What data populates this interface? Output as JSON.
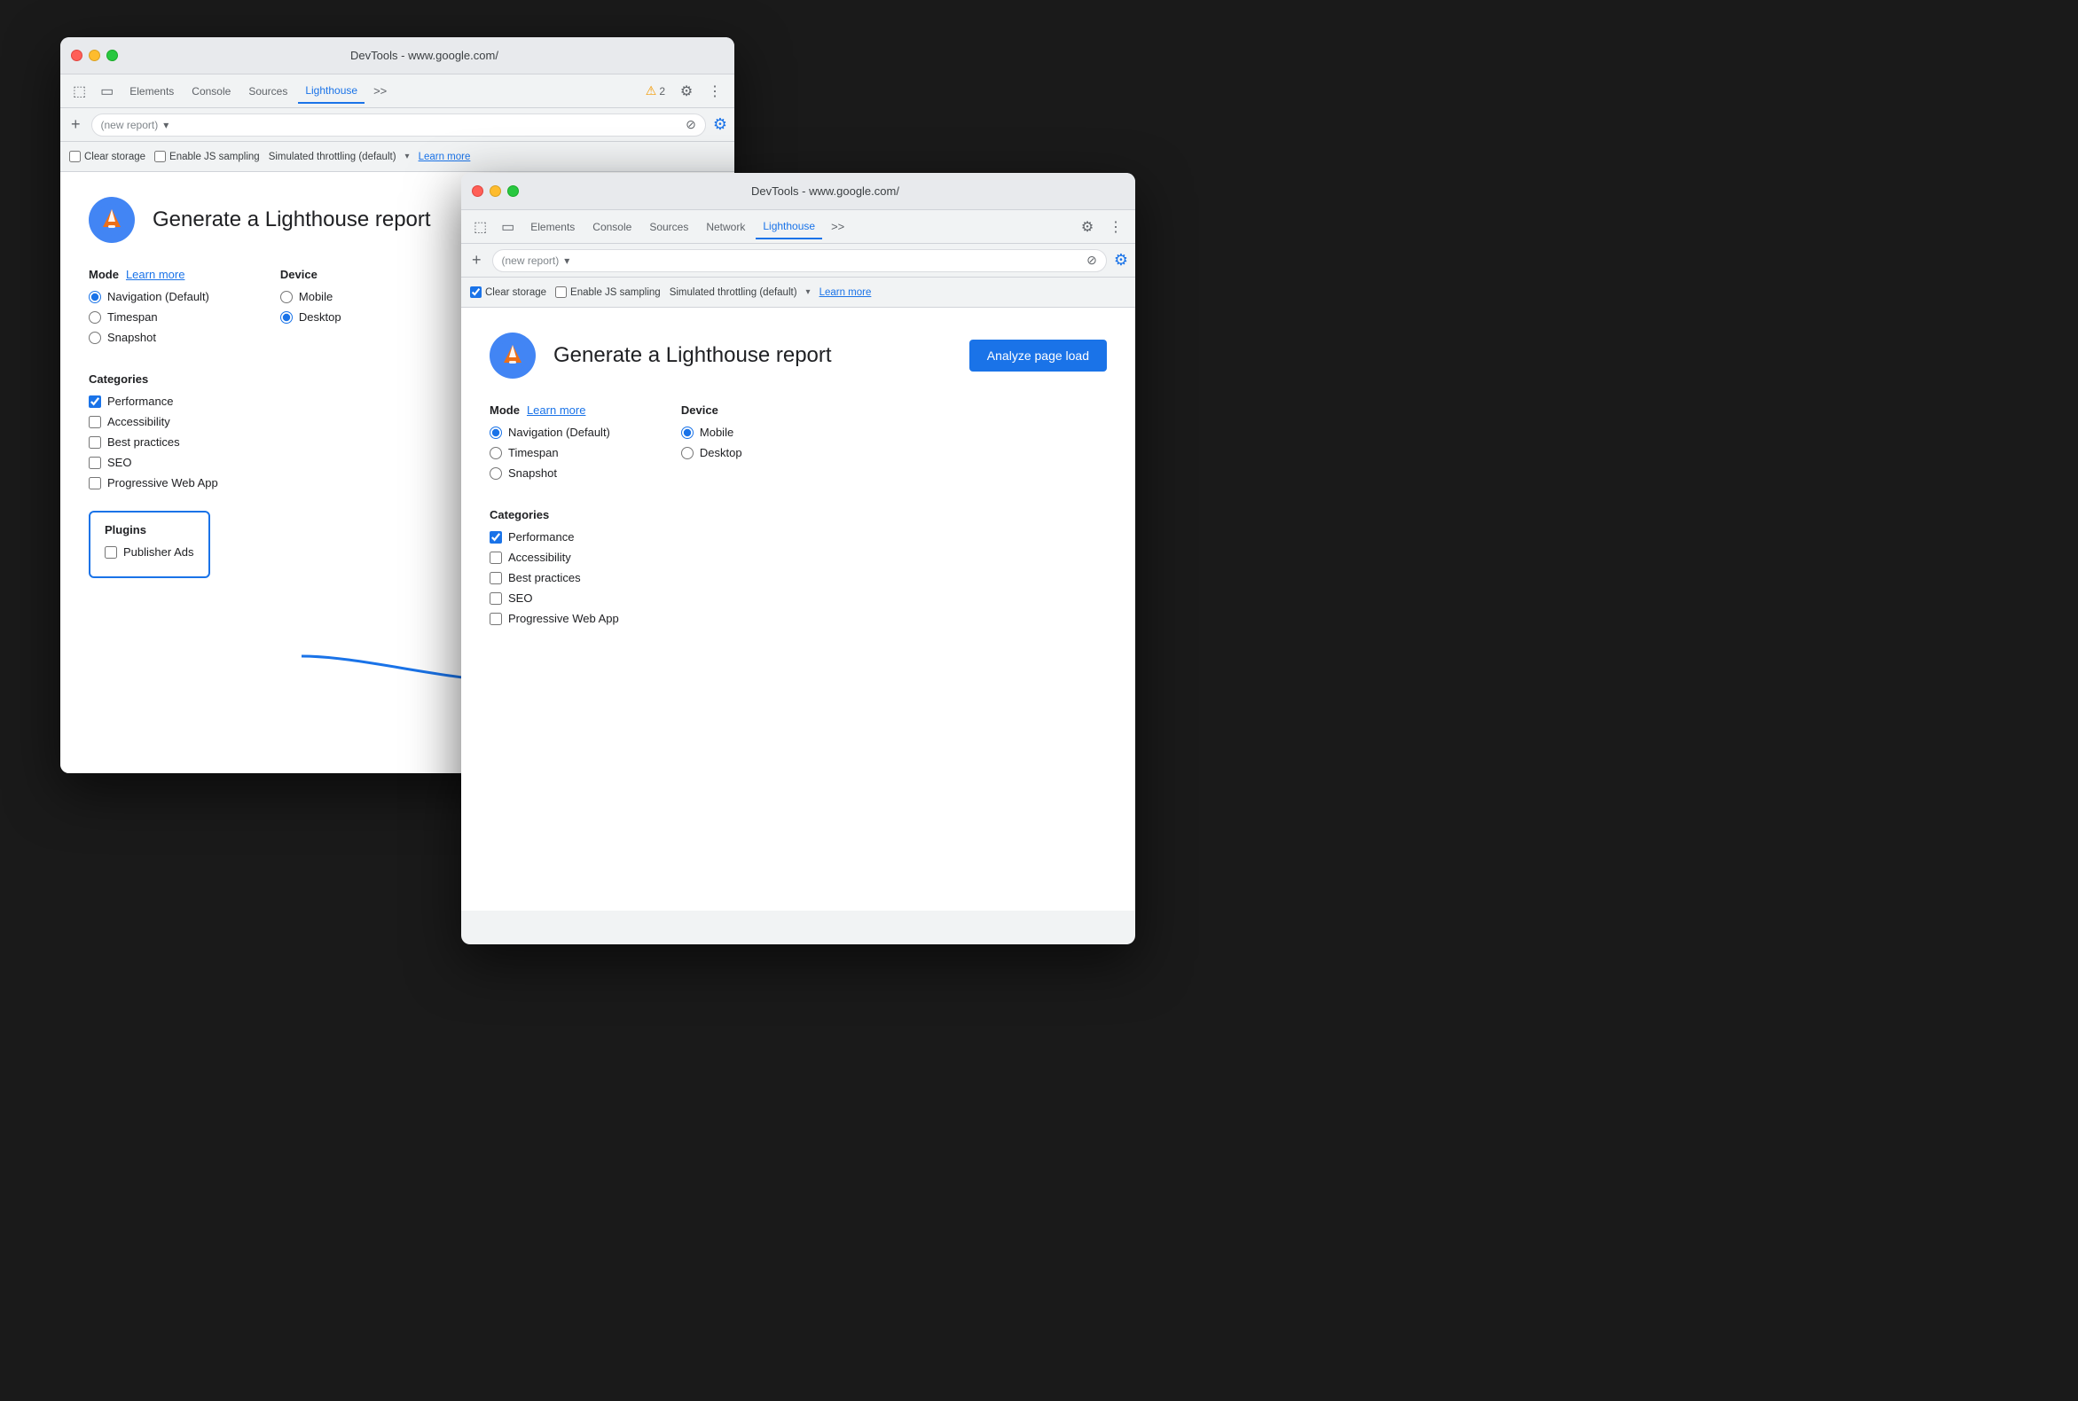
{
  "window1": {
    "titlebar": {
      "title": "DevTools - www.google.com/"
    },
    "tabs": [
      {
        "label": "Elements",
        "active": false
      },
      {
        "label": "Console",
        "active": false
      },
      {
        "label": "Sources",
        "active": false
      },
      {
        "label": "Lighthouse",
        "active": true
      }
    ],
    "more_btn": ">>",
    "warning_count": "2",
    "report_placeholder": "(new report)",
    "options": {
      "clear_storage": "Clear storage",
      "clear_storage_checked": false,
      "enable_js": "Enable JS sampling",
      "enable_js_checked": false,
      "throttling": "Simulated throttling (default)",
      "learn_more": "Learn more"
    },
    "main": {
      "logo_alt": "Lighthouse logo",
      "title": "Generate a Lighthouse report",
      "mode_label": "Mode",
      "learn_more": "Learn more",
      "device_label": "Device",
      "modes": [
        {
          "label": "Navigation (Default)",
          "checked": true
        },
        {
          "label": "Timespan",
          "checked": false
        },
        {
          "label": "Snapshot",
          "checked": false
        }
      ],
      "devices": [
        {
          "label": "Mobile",
          "checked": false
        },
        {
          "label": "Desktop",
          "checked": true
        }
      ],
      "categories_label": "Categories",
      "categories": [
        {
          "label": "Performance",
          "checked": true
        },
        {
          "label": "Accessibility",
          "checked": false
        },
        {
          "label": "Best practices",
          "checked": false
        },
        {
          "label": "SEO",
          "checked": false
        },
        {
          "label": "Progressive Web App",
          "checked": false
        }
      ],
      "plugins_label": "Plugins",
      "plugins": [
        {
          "label": "Publisher Ads",
          "checked": false
        }
      ]
    }
  },
  "window2": {
    "titlebar": {
      "title": "DevTools - www.google.com/"
    },
    "tabs": [
      {
        "label": "Elements",
        "active": false
      },
      {
        "label": "Console",
        "active": false
      },
      {
        "label": "Sources",
        "active": false
      },
      {
        "label": "Network",
        "active": false
      },
      {
        "label": "Lighthouse",
        "active": true
      }
    ],
    "more_btn": ">>",
    "report_placeholder": "(new report)",
    "options": {
      "clear_storage": "Clear storage",
      "clear_storage_checked": true,
      "enable_js": "Enable JS sampling",
      "enable_js_checked": false,
      "throttling": "Simulated throttling (default)",
      "learn_more": "Learn more"
    },
    "main": {
      "logo_alt": "Lighthouse logo",
      "title": "Generate a Lighthouse report",
      "analyze_btn": "Analyze page load",
      "mode_label": "Mode",
      "learn_more": "Learn more",
      "device_label": "Device",
      "modes": [
        {
          "label": "Navigation (Default)",
          "checked": true
        },
        {
          "label": "Timespan",
          "checked": false
        },
        {
          "label": "Snapshot",
          "checked": false
        }
      ],
      "devices": [
        {
          "label": "Mobile",
          "checked": true
        },
        {
          "label": "Desktop",
          "checked": false
        }
      ],
      "categories_label": "Categories",
      "categories": [
        {
          "label": "Performance",
          "checked": true
        },
        {
          "label": "Accessibility",
          "checked": false
        },
        {
          "label": "Best practices",
          "checked": false
        },
        {
          "label": "SEO",
          "checked": false
        },
        {
          "label": "Progressive Web App",
          "checked": false
        }
      ]
    }
  },
  "icons": {
    "gear": "⚙",
    "kebab": "⋮",
    "plus": "+",
    "cancel": "⊘",
    "chevron_down": "▾",
    "warning": "⚠",
    "inspect": "⬚",
    "device": "▭"
  }
}
